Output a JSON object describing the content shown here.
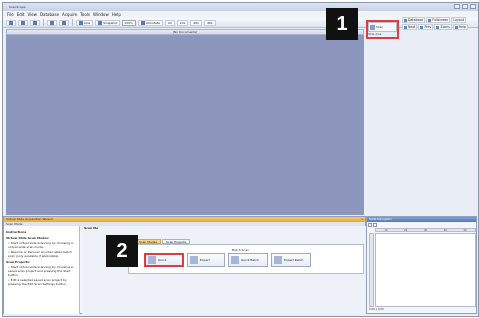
{
  "app": {
    "title": "ScanScope"
  },
  "menu": [
    "File",
    "Edit",
    "View",
    "Database",
    "Acquire",
    "Tools",
    "Window",
    "Help"
  ],
  "toolbar": {
    "items": [
      "Line",
      "Snapshot",
      "Annotate",
      "All",
      "10x",
      "20x",
      "40x"
    ],
    "zoom_field": "100%"
  },
  "ribbon_right": {
    "items": [
      "Scan",
      "Database",
      "Fullscreen",
      "Layout",
      "Next",
      "Prev",
      "Zoom",
      "Help"
    ]
  },
  "scan_button": {
    "label": "Scan",
    "meta": [
      "Slide",
      "Area"
    ]
  },
  "document": {
    "title": "[No Documents]"
  },
  "badges": [
    "1",
    "2"
  ],
  "wizard": {
    "title": "Virtual Slide Acquisition Wizard",
    "subtitle_left": "Scan Mode",
    "instructions_header": "Instructions",
    "main_header": "Scan Mo",
    "sections": [
      {
        "heading": "Virtual Slide Scan Modes:",
        "bullets": [
          "Start virtual slide scanning by choosing a virtual slide scan mode.",
          "Resume or Recover an interrupted batch scan (only available if applicable)."
        ]
      },
      {
        "heading": "Scan Projects:",
        "bullets": [
          "Start virtual slide scanning by choosing a saved scan project and pressing the Start button.",
          "Edit a selected saved scan project by pressing the Edit Scan Settings button."
        ]
      }
    ],
    "tabs": [
      "Virtual Slide Scan Modes",
      "Scan Projects"
    ],
    "panel_label": "Batch Scan",
    "buttons": [
      "Quick",
      "Expert",
      "Quick Batch",
      "Expert Batch"
    ],
    "close_glyph": "x"
  },
  "navigator": {
    "title": "Slide Navigator",
    "ruler": [
      "10",
      "20",
      "30",
      "40",
      "50"
    ],
    "status": "0.00 x 0.00"
  }
}
